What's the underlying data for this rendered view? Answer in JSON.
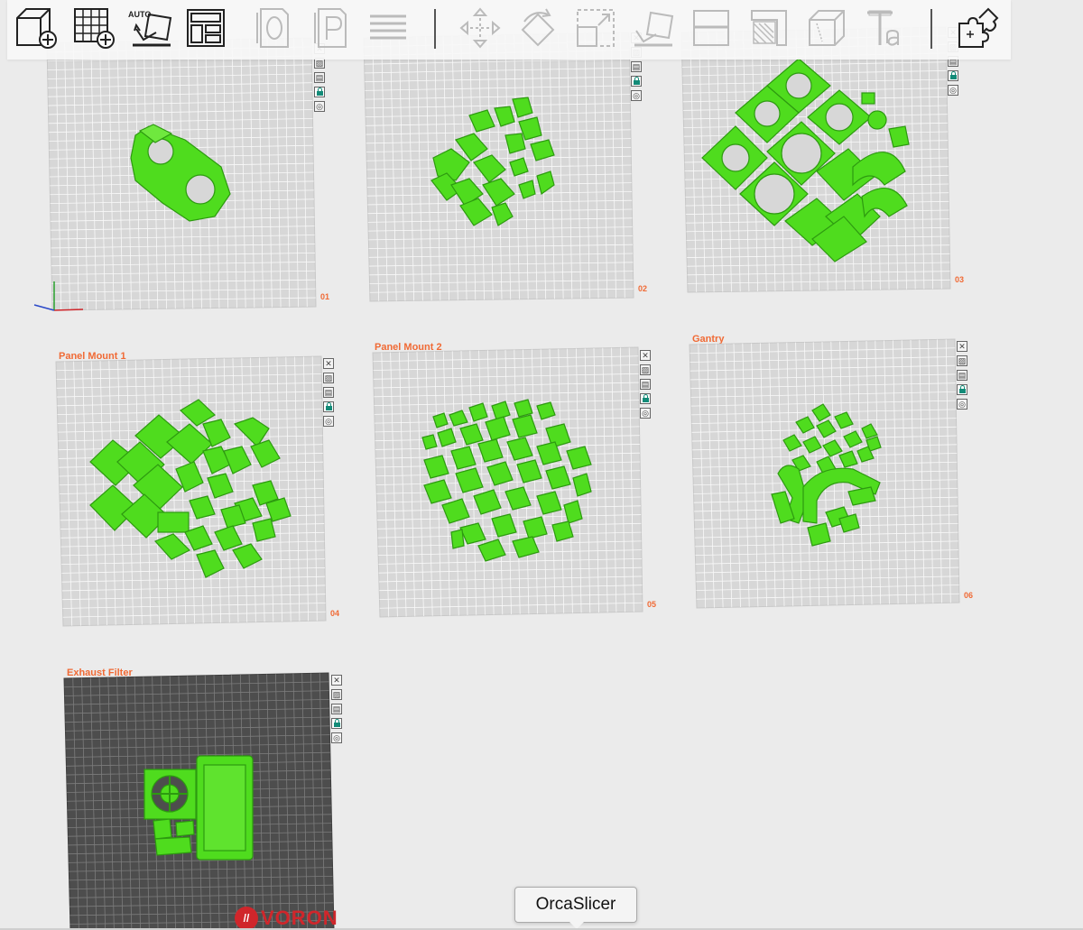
{
  "toolbar": {
    "auto_label": "AUTO",
    "buttons": [
      {
        "name": "add-object",
        "icon": "cube-plus-icon"
      },
      {
        "name": "add-plate",
        "icon": "grid-plus-icon"
      },
      {
        "name": "auto-orient",
        "icon": "auto-orient-icon"
      },
      {
        "name": "arrange",
        "icon": "arrange-layout-icon"
      },
      {
        "name": "split-objects",
        "icon": "split-o-icon"
      },
      {
        "name": "split-parts",
        "icon": "split-p-icon"
      },
      {
        "name": "layers",
        "icon": "layers-icon"
      },
      {
        "name": "move",
        "icon": "move-icon"
      },
      {
        "name": "rotate",
        "icon": "rotate-icon"
      },
      {
        "name": "scale",
        "icon": "scale-icon"
      },
      {
        "name": "lay-on-face",
        "icon": "lay-on-face-icon"
      },
      {
        "name": "cut",
        "icon": "cut-icon"
      },
      {
        "name": "support-paint",
        "icon": "support-paint-icon"
      },
      {
        "name": "seam-paint",
        "icon": "seam-paint-icon"
      },
      {
        "name": "text",
        "icon": "text-icon"
      },
      {
        "name": "assembly",
        "icon": "puzzle-icon"
      }
    ]
  },
  "plates": [
    {
      "number": "01",
      "name": ""
    },
    {
      "number": "02",
      "name": ""
    },
    {
      "number": "03",
      "name": ""
    },
    {
      "number": "04",
      "name": "Panel Mount 1"
    },
    {
      "number": "05",
      "name": "Panel Mount 2"
    },
    {
      "number": "06",
      "name": "Gantry"
    },
    {
      "number": "",
      "name": "Exhaust Filter"
    }
  ],
  "plate_icons": {
    "close": "close-icon",
    "thumbnail": "image-icon",
    "settings": "plate-settings-icon",
    "lock": "lock-icon",
    "target": "target-icon"
  },
  "tooltip": {
    "text": "OrcaSlicer"
  },
  "watermark": {
    "text": "VORON"
  },
  "colors": {
    "part": "#4fdc1e",
    "part_dark": "#2d9a10",
    "bed": "#d7d7d7",
    "bed_active": "#4d4d4d",
    "accent": "#f06a35",
    "lock": "#138b78"
  }
}
